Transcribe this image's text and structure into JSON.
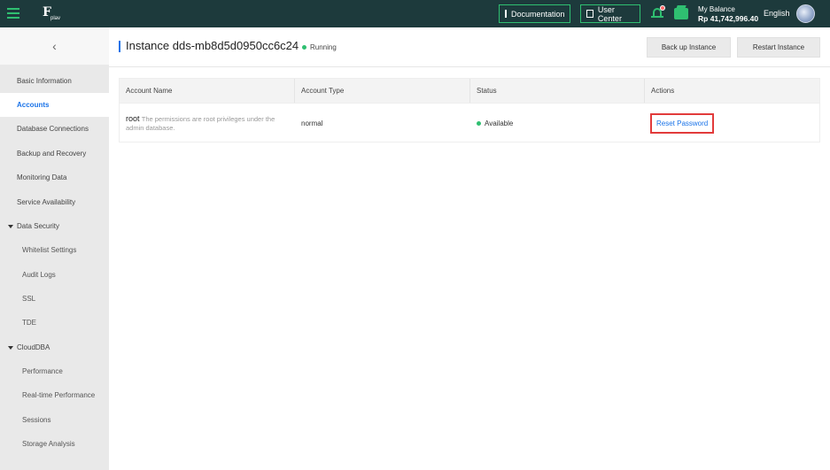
{
  "topbar": {
    "logo_text": "F",
    "logo_sub": "plav",
    "documentation_label": "Documentation",
    "user_center_label": "User Center",
    "balance_label": "My Balance",
    "balance_amount": "Rp 41,742,996.40",
    "language": "English",
    "icons": [
      "menu-icon",
      "document-icon",
      "monitor-icon",
      "bell-icon",
      "wallet-icon"
    ],
    "accent_color": "#2fbf71",
    "bg_color": "#1d3a3c"
  },
  "sidebar": {
    "back_glyph": "‹",
    "items": [
      {
        "label": "Basic Information"
      },
      {
        "label": "Accounts",
        "active": true
      },
      {
        "label": "Database Connections"
      },
      {
        "label": "Backup and Recovery"
      },
      {
        "label": "Monitoring Data"
      },
      {
        "label": "Service Availability"
      },
      {
        "label": "Data Security",
        "group": true
      },
      {
        "label": "Whitelist Settings"
      },
      {
        "label": "Audit Logs"
      },
      {
        "label": "SSL"
      },
      {
        "label": "TDE"
      },
      {
        "label": "CloudDBA",
        "group": true
      },
      {
        "label": "Performance"
      },
      {
        "label": "Real-time Performance"
      },
      {
        "label": "Sessions"
      },
      {
        "label": "Storage Analysis"
      }
    ]
  },
  "header": {
    "title": "Instance dds-mb8d5d0950cc6c24",
    "status": "Running",
    "backup_label": "Back up Instance",
    "restart_label": "Restart Instance"
  },
  "table": {
    "columns": [
      "Account Name",
      "Account Type",
      "Status",
      "Actions"
    ],
    "rows": [
      {
        "name": "root",
        "description": "The permissions are root privileges under the admin database.",
        "type": "normal",
        "status": "Available",
        "action": "Reset Password"
      }
    ]
  }
}
